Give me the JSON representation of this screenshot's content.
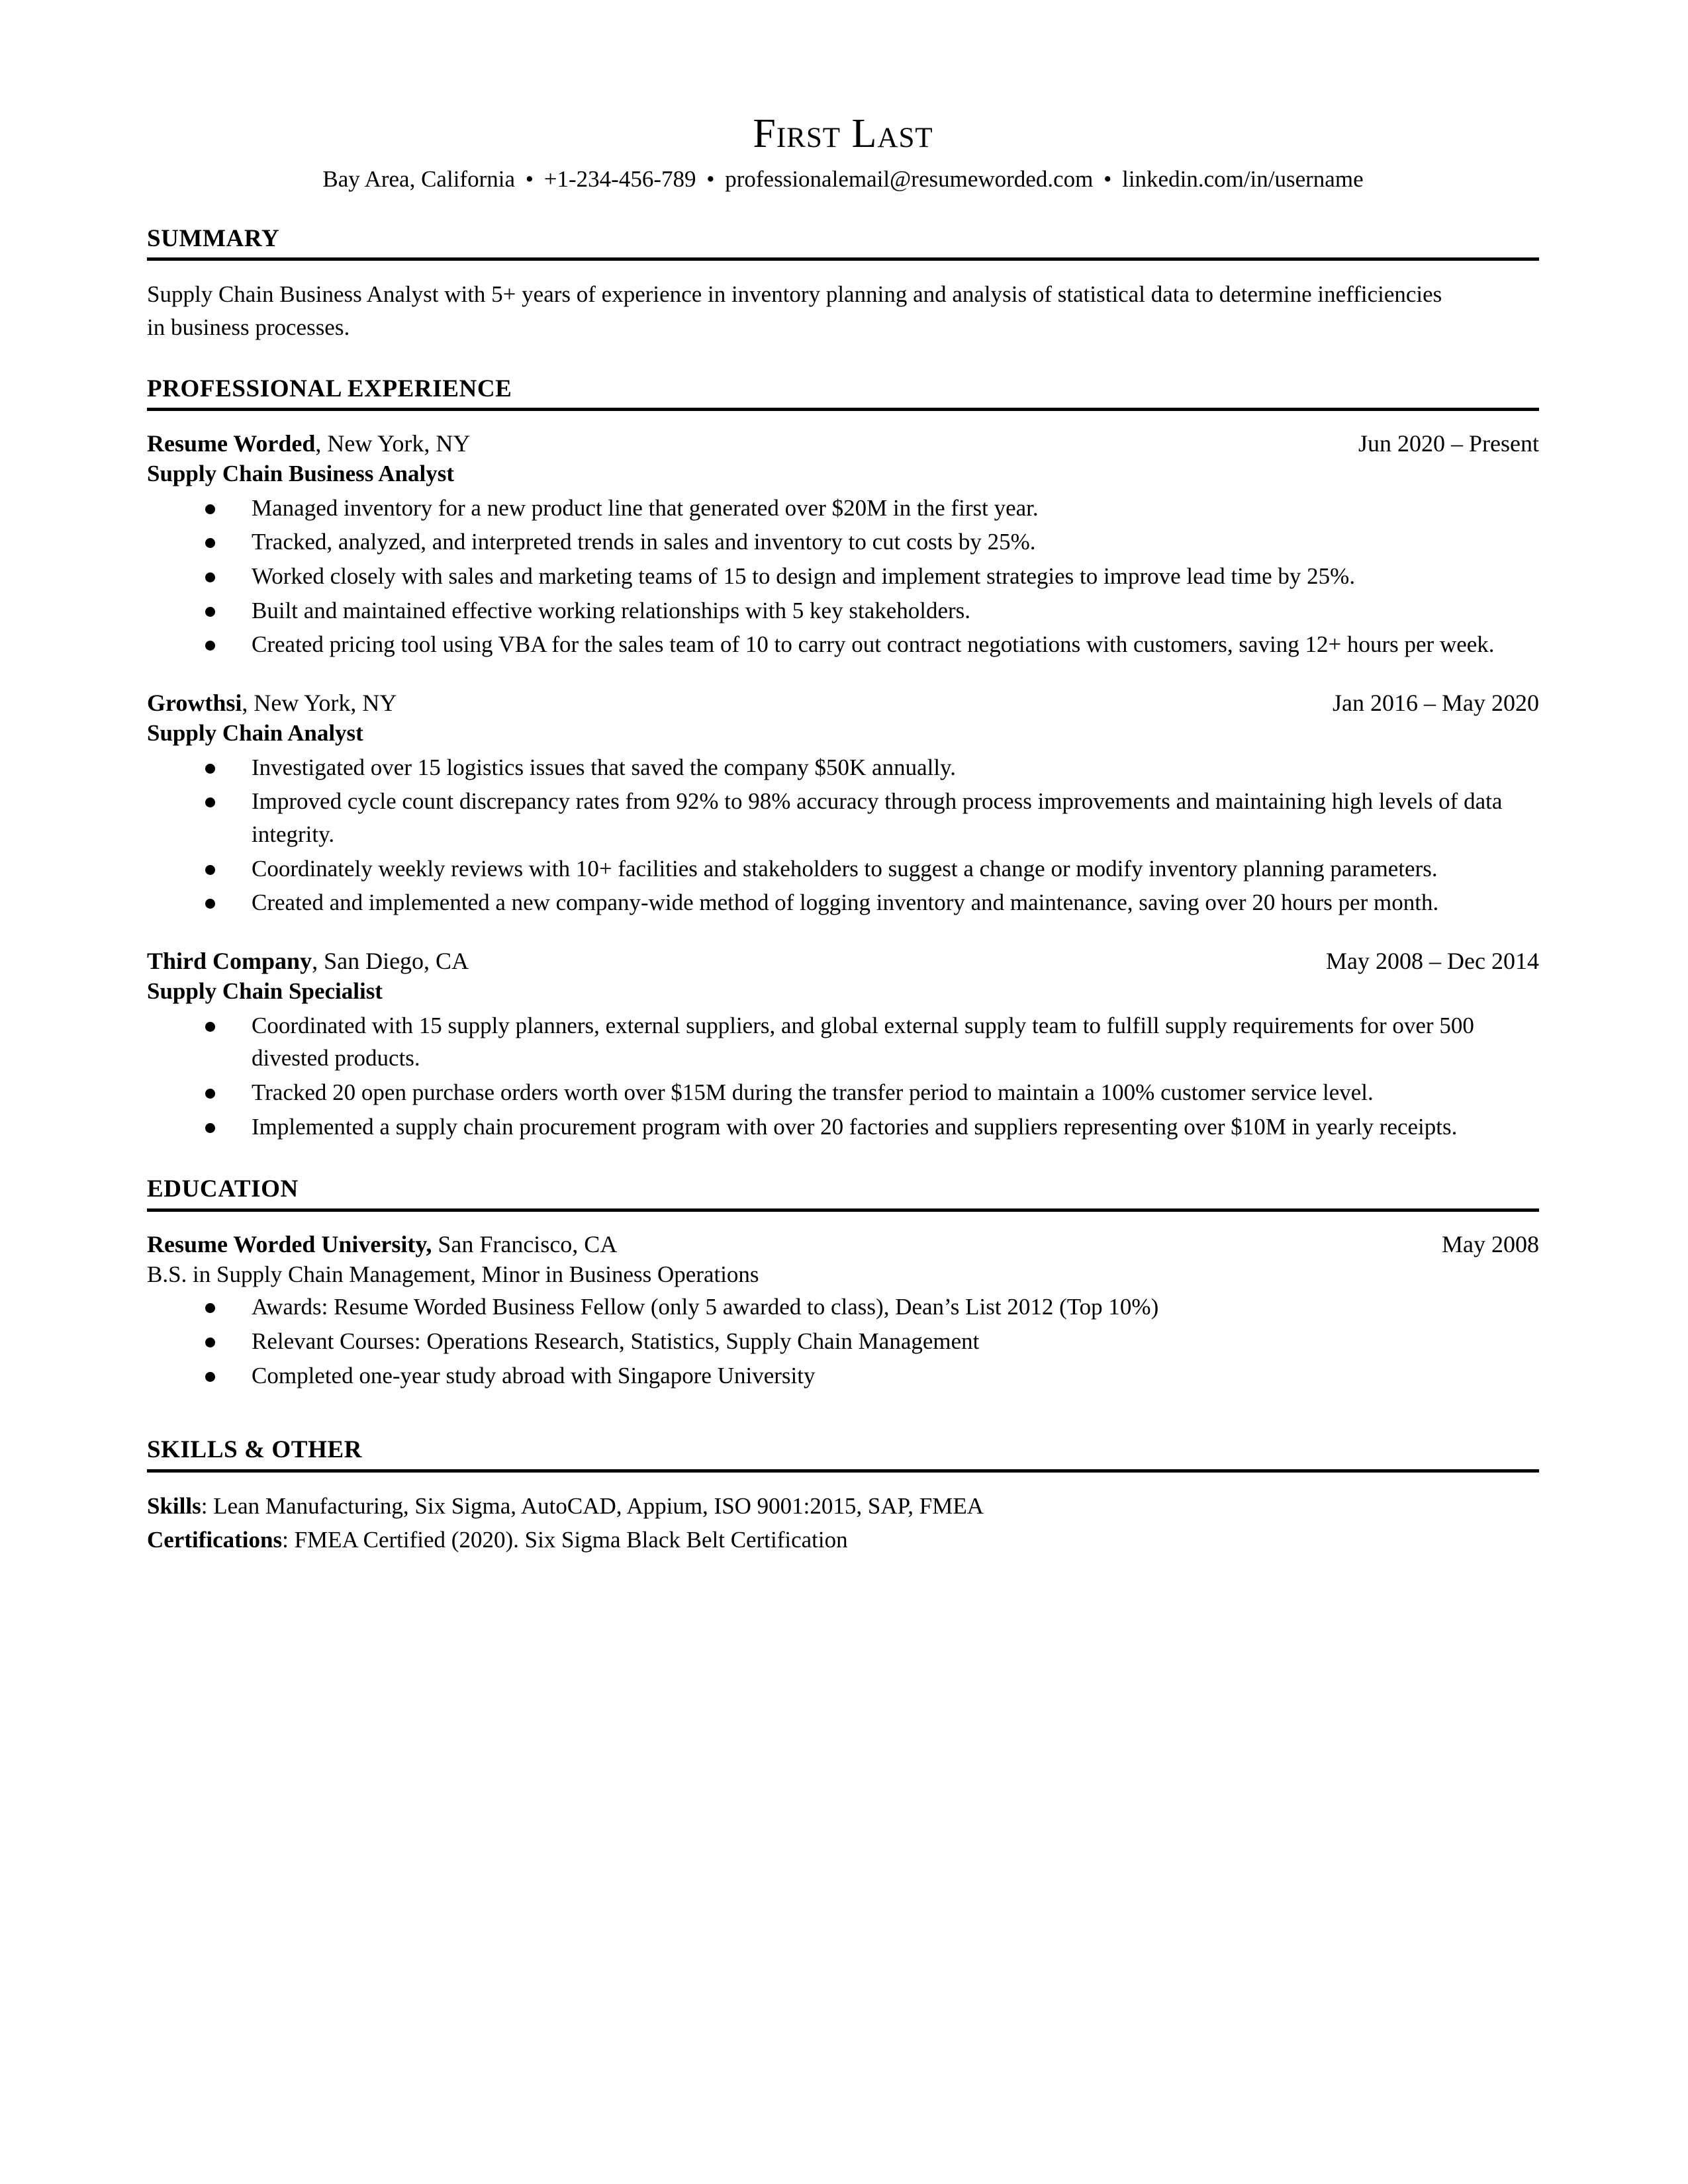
{
  "header": {
    "name": "First Last",
    "contact": {
      "location": "Bay Area, California",
      "phone": "+1-234-456-789",
      "email": "professionalemail@resumeworded.com",
      "linkedin": "linkedin.com/in/username",
      "separator": "•"
    }
  },
  "sections": {
    "summary": {
      "title": "SUMMARY",
      "text": "Supply Chain Business Analyst with 5+ years of experience in inventory planning and analysis of statistical data to determine inefficiencies in business processes."
    },
    "experience": {
      "title": "PROFESSIONAL EXPERIENCE",
      "entries": [
        {
          "org": "Resume Worded",
          "location": ", New York, NY",
          "date": "Jun 2020 – Present",
          "role": "Supply Chain Business Analyst",
          "bullets": [
            "Managed inventory for a new product line that generated over $20M in the first year.",
            "Tracked, analyzed, and interpreted trends in sales and inventory to cut costs by 25%.",
            "Worked closely with sales and marketing teams of 15 to design and implement strategies to improve lead time by 25%.",
            "Built and maintained effective working relationships with 5 key stakeholders.",
            "Created pricing tool using VBA for the sales team of 10 to carry out contract negotiations with customers, saving 12+ hours per week."
          ]
        },
        {
          "org": "Growthsi",
          "location": ", New York, NY",
          "date": "Jan 2016 – May 2020",
          "role": "Supply Chain Analyst",
          "bullets": [
            "Investigated over 15 logistics issues that saved the company $50K annually.",
            "Improved cycle count discrepancy rates from 92% to 98% accuracy through process improvements and maintaining high levels of data integrity.",
            "Coordinately weekly reviews with 10+ facilities and stakeholders to suggest a change or modify inventory planning parameters.",
            "Created and implemented a new company-wide method of logging inventory and maintenance, saving over 20 hours per month."
          ]
        },
        {
          "org": "Third Company",
          "location": ", San Diego, CA",
          "date": "May 2008 – Dec 2014",
          "role": "Supply Chain Specialist",
          "bullets": [
            "Coordinated with 15 supply planners, external suppliers, and global external supply team to fulfill supply requirements for over 500 divested products.",
            "Tracked 20 open purchase orders worth over $15M during the transfer period to maintain a 100% customer service level.",
            "Implemented a supply chain procurement program with over 20 factories and suppliers representing over $10M in yearly receipts."
          ]
        }
      ]
    },
    "education": {
      "title": "EDUCATION",
      "entries": [
        {
          "org": "Resume Worded University,",
          "location": " San Francisco, CA",
          "date": "May 2008",
          "degree": "B.S. in Supply Chain Management, Minor in Business Operations",
          "bullets": [
            "Awards: Resume Worded Business Fellow (only 5 awarded to class), Dean’s List 2012 (Top 10%)",
            "Relevant Courses: Operations Research, Statistics, Supply Chain Management",
            "Completed one-year study abroad with Singapore University"
          ]
        }
      ]
    },
    "skills": {
      "title": "SKILLS & OTHER",
      "lines": [
        {
          "label": "Skills",
          "value": ": Lean Manufacturing, Six Sigma, AutoCAD, Appium, ISO 9001:2015, SAP, FMEA"
        },
        {
          "label": "Certifications",
          "value": ": FMEA Certified  (2020). Six Sigma Black Belt Certification"
        }
      ]
    }
  }
}
